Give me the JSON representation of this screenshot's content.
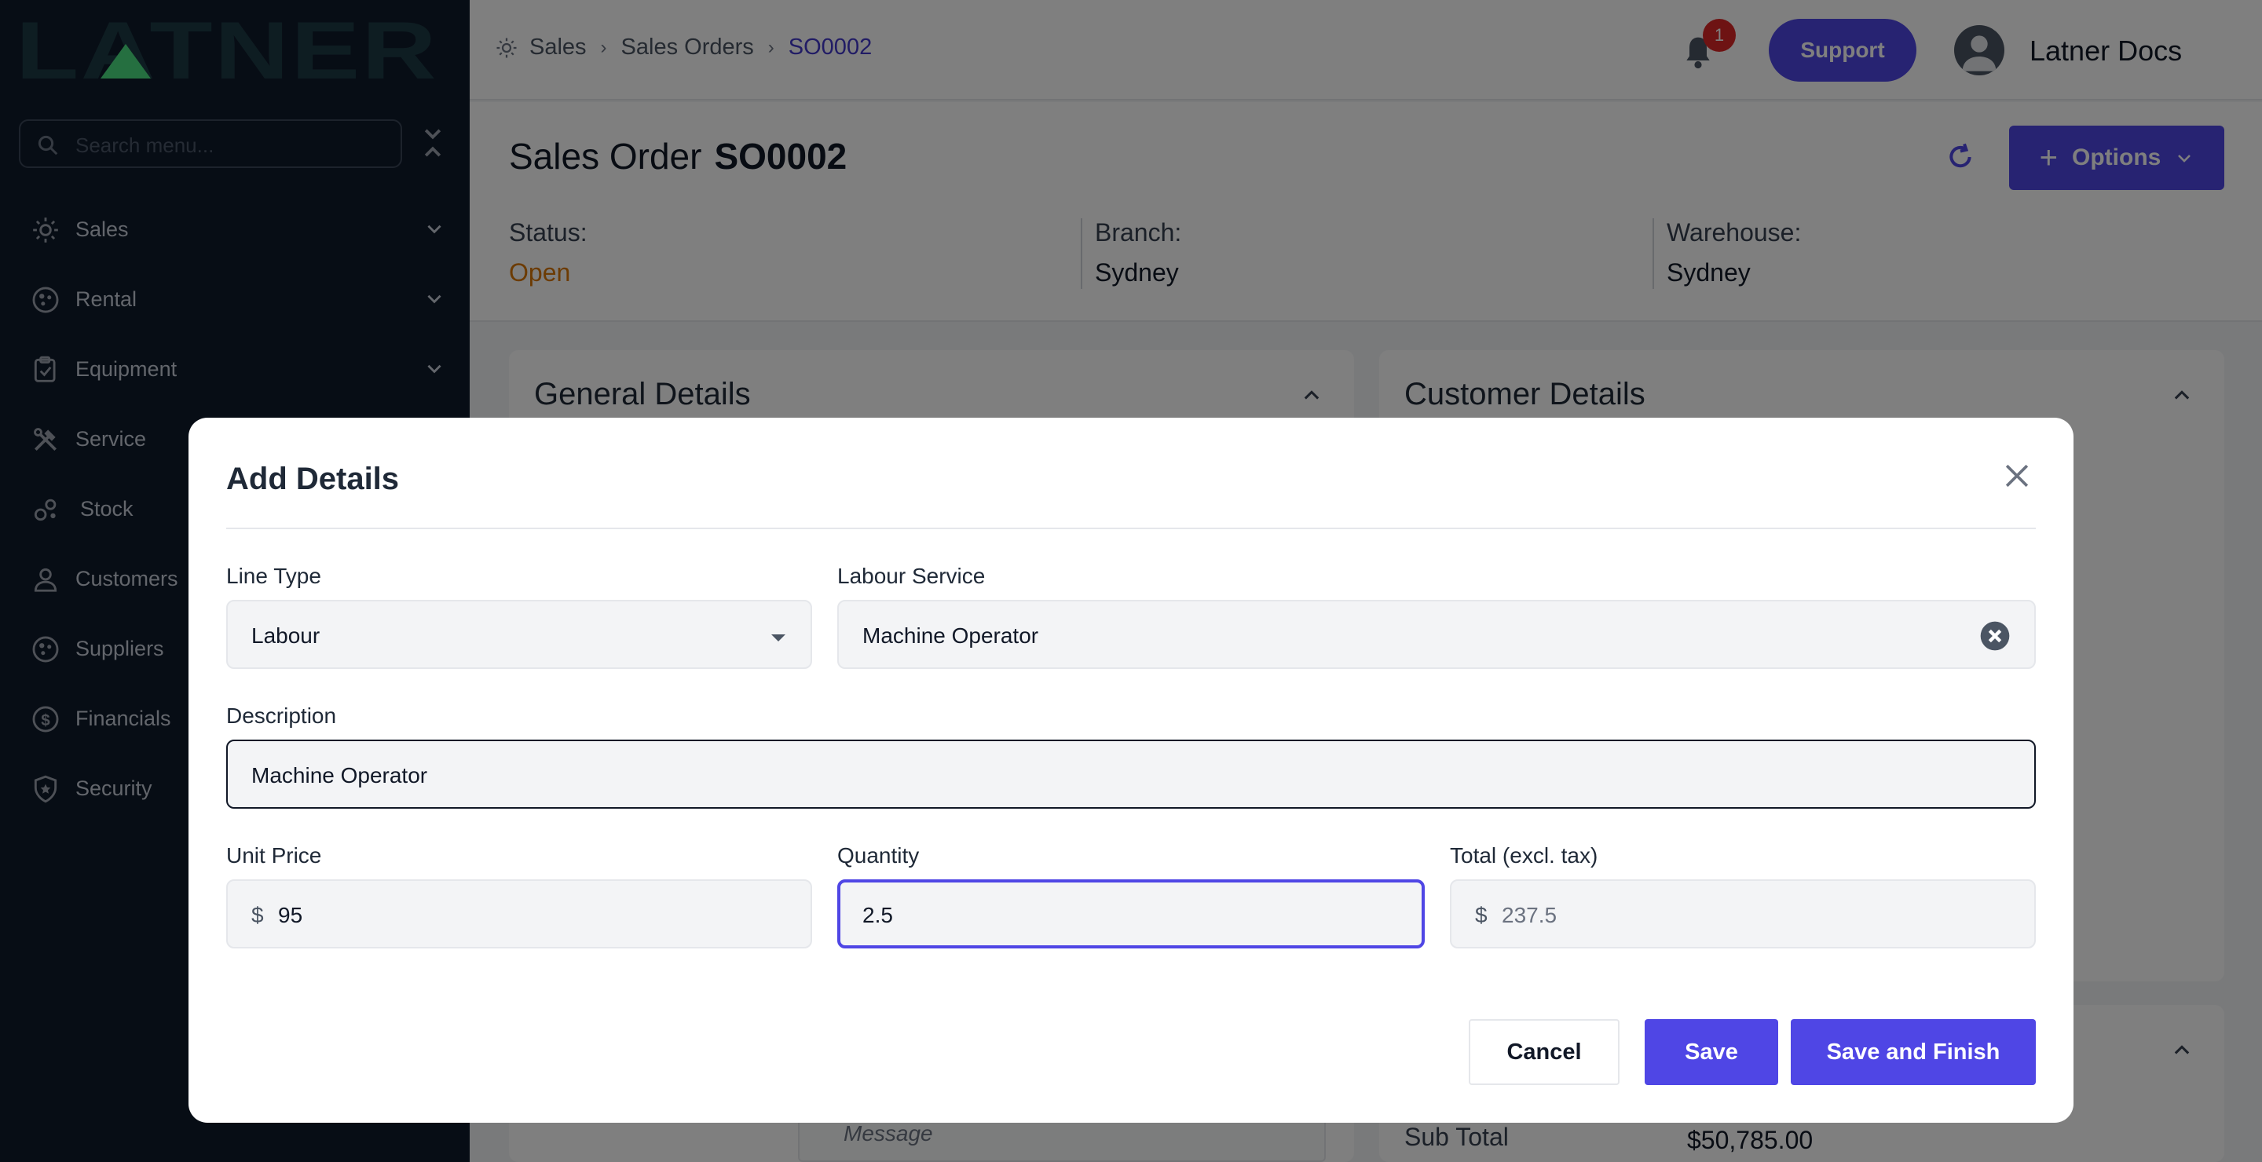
{
  "sidebar": {
    "logo_text": "LATNER",
    "search_placeholder": "Search menu...",
    "items": [
      {
        "label": "Sales",
        "icon": "sales-icon",
        "expandable": true
      },
      {
        "label": "Rental",
        "icon": "rental-icon",
        "expandable": true
      },
      {
        "label": "Equipment",
        "icon": "equipment-icon",
        "expandable": true
      },
      {
        "label": "Service",
        "icon": "service-icon",
        "expandable": false
      },
      {
        "label": "Stock",
        "icon": "stock-icon",
        "expandable": false
      },
      {
        "label": "Customers",
        "icon": "customers-icon",
        "expandable": false
      },
      {
        "label": "Suppliers",
        "icon": "suppliers-icon",
        "expandable": false
      },
      {
        "label": "Financials",
        "icon": "financials-icon",
        "expandable": false
      },
      {
        "label": "Security",
        "icon": "security-icon",
        "expandable": false
      }
    ]
  },
  "header": {
    "breadcrumbs": [
      "Sales",
      "Sales Orders",
      "SO0002"
    ],
    "notification_count": "1",
    "support_label": "Support",
    "user_name": "Latner Docs"
  },
  "order": {
    "title_prefix": "Sales Order",
    "number": "SO0002",
    "options_label": "Options",
    "status_label": "Status:",
    "status_value": "Open",
    "branch_label": "Branch:",
    "branch_value": "Sydney",
    "warehouse_label": "Warehouse:",
    "warehouse_value": "Sydney"
  },
  "cards": {
    "general_title": "General Details",
    "customer_title": "Customer Details",
    "message_placeholder": "Message",
    "subtotal_label": "Sub Total",
    "subtotal_value": "$50,785.00"
  },
  "modal": {
    "title": "Add Details",
    "line_type_label": "Line Type",
    "line_type_value": "Labour",
    "labour_service_label": "Labour Service",
    "labour_service_value": "Machine Operator",
    "description_label": "Description",
    "description_value": "Machine Operator",
    "unit_price_label": "Unit Price",
    "unit_price_currency": "$",
    "unit_price_value": "95",
    "quantity_label": "Quantity",
    "quantity_value": "2.5",
    "total_label": "Total (excl. tax)",
    "total_currency": "$",
    "total_value": "237.5",
    "cancel_label": "Cancel",
    "save_label": "Save",
    "save_finish_label": "Save and Finish"
  },
  "colors": {
    "sidebar_bg": "#0f1a2a",
    "accent": "#4f46e5",
    "status_open": "#d97706",
    "badge": "#dc2626"
  }
}
